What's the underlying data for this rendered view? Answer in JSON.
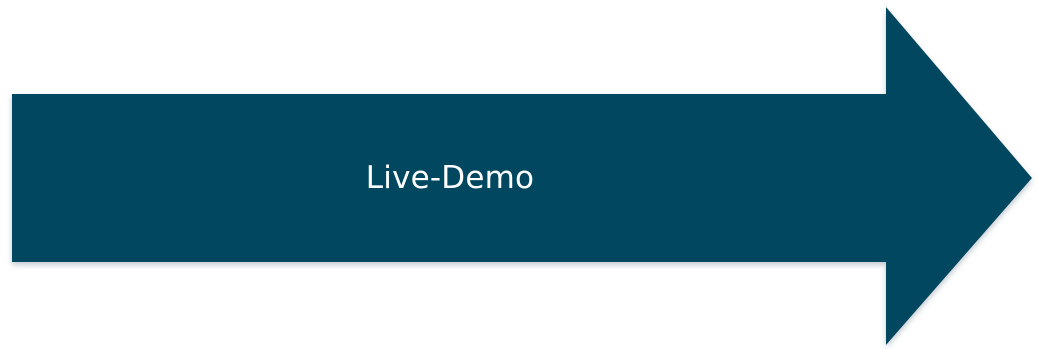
{
  "arrow": {
    "label": "Live-Demo",
    "fill_color": "#00465e",
    "shadow_color": "#8a9aa6",
    "direction": "right"
  }
}
